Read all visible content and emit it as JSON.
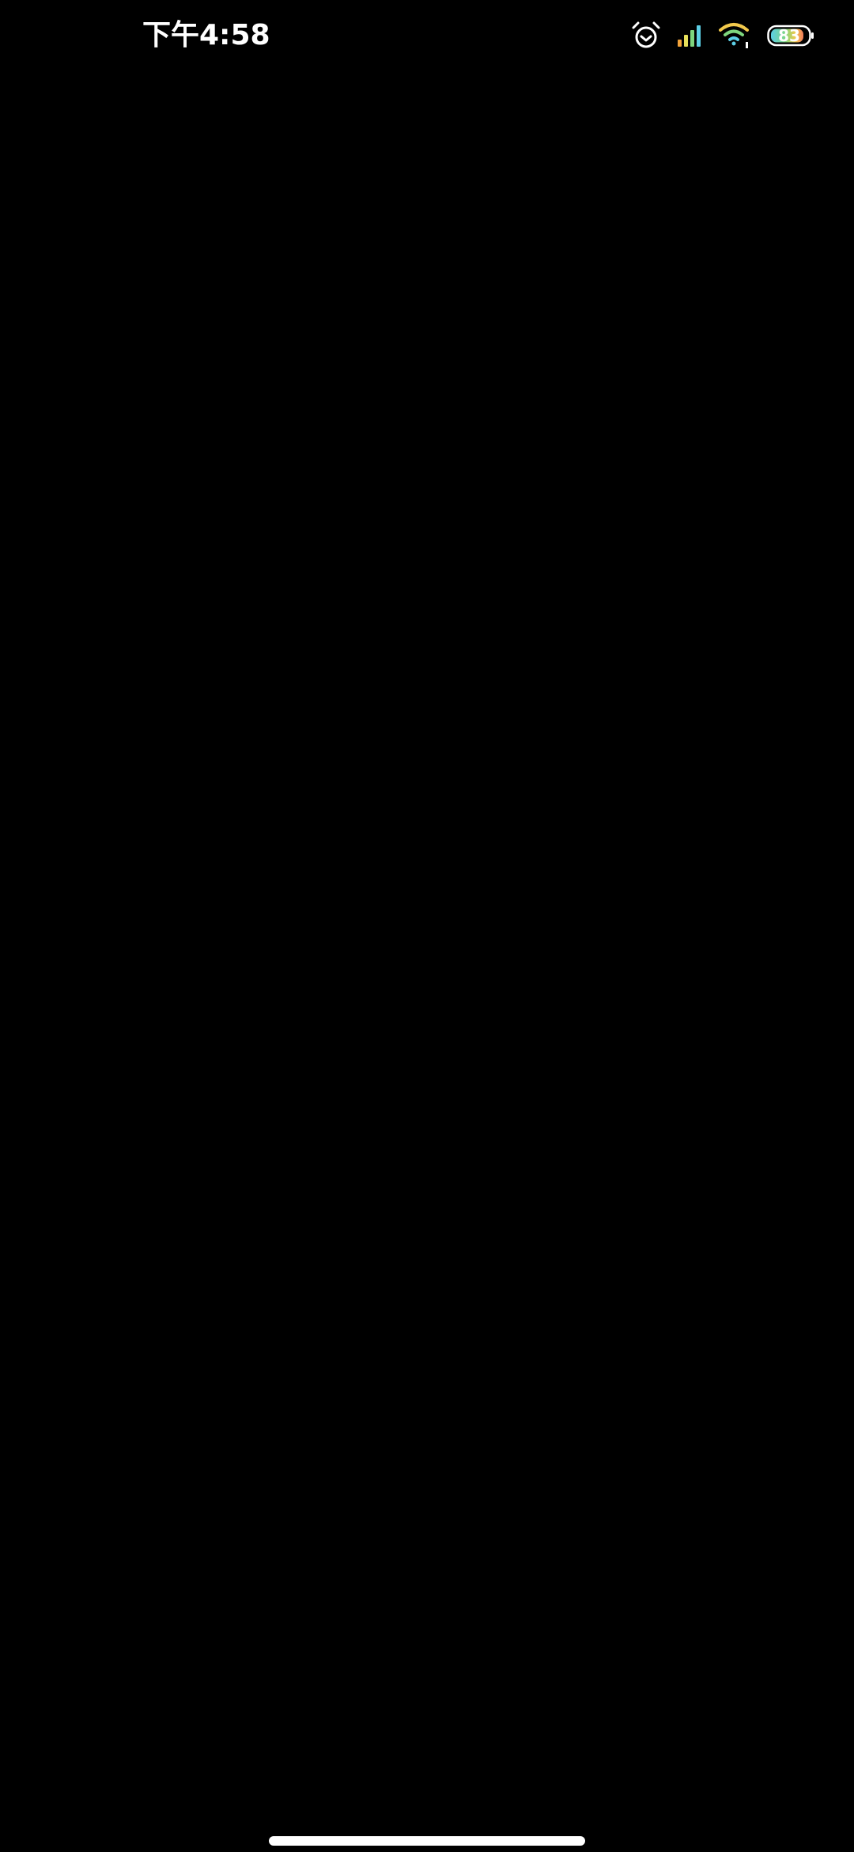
{
  "status_bar": {
    "time": "下午4:58",
    "battery_level": "83",
    "icons": [
      "alarm-icon",
      "signal-icon",
      "wifi-icon",
      "battery-icon"
    ],
    "colors": {
      "text": "#ffffff",
      "signal_bars": [
        "#f2a33a",
        "#e8e05a",
        "#7ed67e",
        "#5ccfe6"
      ],
      "wifi_arcs": [
        "#f2c94c",
        "#7ed67e",
        "#5ccfe6"
      ],
      "battery_fill": [
        "#5ccfe6",
        "#7ed67e",
        "#f2c94c",
        "#f27a5c"
      ]
    }
  }
}
